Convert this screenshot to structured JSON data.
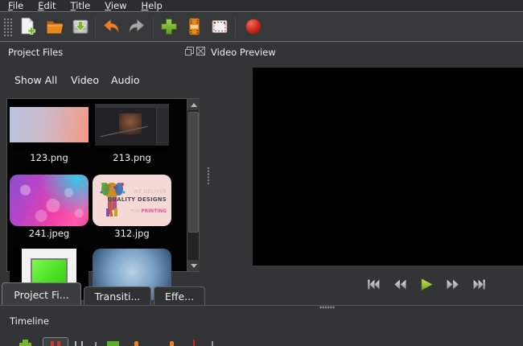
{
  "menu_bar": {
    "items": [
      {
        "label": "File"
      },
      {
        "label": "Edit"
      },
      {
        "label": "Title"
      },
      {
        "label": "View"
      },
      {
        "label": "Help"
      }
    ]
  },
  "toolbar": {
    "icons": [
      "new-project",
      "open-project",
      "save-project",
      "undo",
      "redo",
      "import-files",
      "choose-profile",
      "fullscreen",
      "export-video"
    ]
  },
  "project_files_panel": {
    "title": "Project Files",
    "filters": [
      {
        "label": "Show All"
      },
      {
        "label": "Video"
      },
      {
        "label": "Audio"
      }
    ],
    "files": [
      {
        "label": "123.png"
      },
      {
        "label": "213.png"
      },
      {
        "label": "241.jpeg"
      },
      {
        "label": "312.jpg"
      }
    ],
    "file_312_text": {
      "line1": "WE DELIVER",
      "line2": "QUALITY DESIGNS",
      "line3a": "FOR ",
      "line3b": "PRINTING"
    }
  },
  "tabs": [
    {
      "label": "Project Fi..."
    },
    {
      "label": "Transiti..."
    },
    {
      "label": "Effe..."
    }
  ],
  "video_preview_panel": {
    "title": "Video Preview",
    "transport": [
      "jump-to-start",
      "rewind",
      "play",
      "fast-forward",
      "jump-to-end"
    ]
  },
  "timeline_panel": {
    "title": "Timeline"
  },
  "colors": {
    "accent_green": "#76b62c",
    "play_green": "#8ec63f",
    "undo_orange": "#e8822a",
    "folder_orange": "#e8891f",
    "record_red": "#cc2a20",
    "list_background": "#020202",
    "window_background": "#333435"
  }
}
